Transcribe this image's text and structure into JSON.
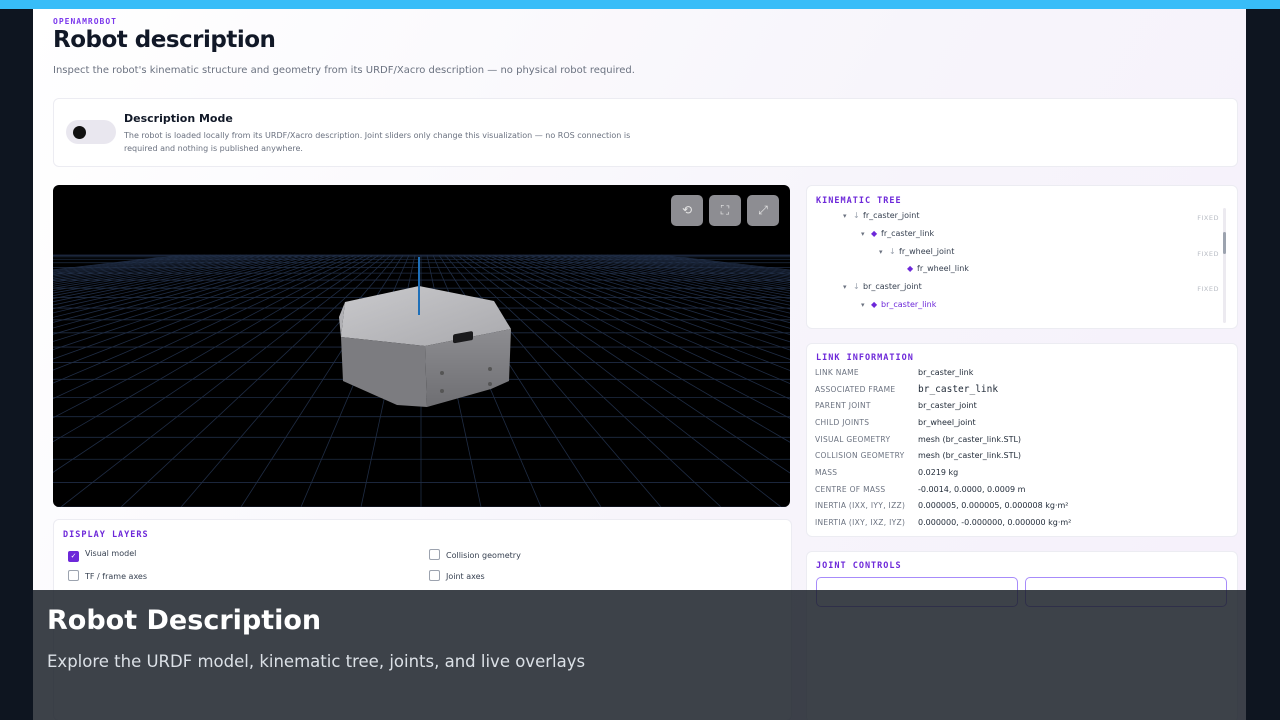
{
  "header": {
    "brand": "OPENAMROBOT",
    "title": "Robot description",
    "subtitle": "Inspect the robot's kinematic structure and geometry from its URDF/Xacro description — no physical robot required."
  },
  "mode": {
    "title": "Description Mode",
    "description": "The robot is loaded locally from its URDF/Xacro description. Joint sliders only change this visualization — no ROS connection is required and nothing is published anywhere.",
    "enabled": false
  },
  "viewport": {
    "buttons": [
      {
        "name": "reset-view-icon",
        "glyph": "⟲"
      },
      {
        "name": "fit-view-icon",
        "glyph": "⛶"
      },
      {
        "name": "fullscreen-icon",
        "glyph": "⤢"
      }
    ]
  },
  "tree": {
    "title": "KINEMATIC TREE",
    "fixed_label": "FIXED",
    "rows": [
      {
        "label": "fr_caster_joint",
        "type": "joint",
        "fixed": true
      },
      {
        "label": "fr_caster_link",
        "type": "link",
        "fixed": false
      },
      {
        "label": "fr_wheel_joint",
        "type": "joint",
        "fixed": true
      },
      {
        "label": "fr_wheel_link",
        "type": "link",
        "fixed": false
      },
      {
        "label": "br_caster_joint",
        "type": "joint",
        "fixed": true
      },
      {
        "label": "br_caster_link",
        "type": "link",
        "fixed": false,
        "selected": true
      }
    ]
  },
  "link_info": {
    "title": "LINK INFORMATION",
    "rows": [
      {
        "key": "LINK NAME",
        "value": "br_caster_link"
      },
      {
        "key": "ASSOCIATED FRAME",
        "value": "br_caster_link",
        "mono": true
      },
      {
        "key": "PARENT JOINT",
        "value": "br_caster_joint"
      },
      {
        "key": "CHILD JOINTS",
        "value": "br_wheel_joint"
      },
      {
        "key": "VISUAL GEOMETRY",
        "value": "mesh (br_caster_link.STL)"
      },
      {
        "key": "COLLISION GEOMETRY",
        "value": "mesh (br_caster_link.STL)"
      },
      {
        "key": "MASS",
        "value": "0.0219 kg"
      },
      {
        "key": "CENTRE OF MASS",
        "value": "-0.0014, 0.0000, 0.0009 m"
      },
      {
        "key": "INERTIA (IXX, IYY, IZZ)",
        "value": "0.000005, 0.000005, 0.000008 kg·m²"
      },
      {
        "key": "INERTIA (IXY, IXZ, IYZ)",
        "value": "0.000000, -0.000000, 0.000000 kg·m²"
      }
    ]
  },
  "layers": {
    "title": "DISPLAY LAYERS",
    "items": [
      {
        "label": "Visual model",
        "checked": true
      },
      {
        "label": "Collision geometry",
        "checked": false
      },
      {
        "label": "TF / frame axes",
        "checked": false
      },
      {
        "label": "Joint axes",
        "checked": false
      }
    ]
  },
  "joint_controls": {
    "title": "JOINT CONTROLS"
  },
  "caption": {
    "title": "Robot Description",
    "subtitle": "Explore the URDF model, kinematic tree, joints, and live overlays"
  },
  "colors": {
    "accent": "#6d28d9",
    "topbar": "#38bdf8"
  }
}
